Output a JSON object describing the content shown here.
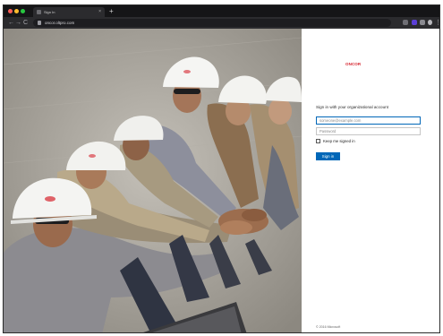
{
  "browser": {
    "tab_title": "Sign In",
    "tab_close": "×",
    "new_tab": "+",
    "nav": {
      "back": "←",
      "forward": "→",
      "reload": "C"
    },
    "url": "oncor.oltpro.com",
    "menu": "⋮",
    "extensions": [
      "extension-icon",
      "purple-extension-icon",
      "puzzle-icon",
      "profile-avatar-icon"
    ]
  },
  "photo": {
    "description_icon": "team-hands-together-photo",
    "palette": {
      "shirt": "#8f8e92",
      "helmet": "#f4f4f2",
      "ground": "#a9a59d"
    }
  },
  "signin": {
    "logo": "ONCOR",
    "heading": "Sign in with your organizational account",
    "username_placeholder": "someone@example.com",
    "password_placeholder": "Password",
    "keep_signed_in": "Keep me signed in",
    "button": "Sign in",
    "footer": "© 2016 Microsoft",
    "accent": "#0067b8",
    "brand_red": "#d5232d"
  }
}
